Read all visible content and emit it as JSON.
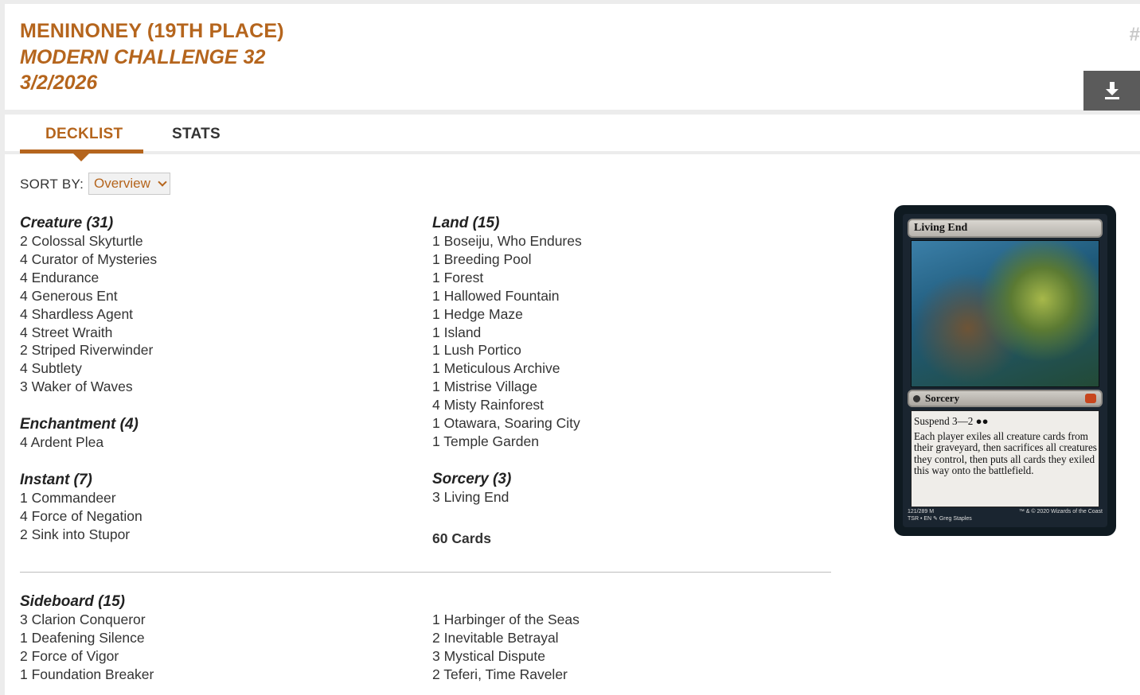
{
  "header": {
    "player": "MENINONEY (19TH PLACE)",
    "event": "MODERN CHALLENGE 32",
    "date": "3/2/2026",
    "hash_mark": "#"
  },
  "tabs": [
    {
      "label": "DECKLIST",
      "active": true
    },
    {
      "label": "STATS",
      "active": false
    }
  ],
  "sort": {
    "label": "SORT BY:",
    "selected": "Overview"
  },
  "maindeck": {
    "left_column": [
      {
        "title": "Creature (31)",
        "cards": [
          "2 Colossal Skyturtle",
          "4 Curator of Mysteries",
          "4 Endurance",
          "4 Generous Ent",
          "4 Shardless Agent",
          "4 Street Wraith",
          "2 Striped Riverwinder",
          "4 Subtlety",
          "3 Waker of Waves"
        ]
      },
      {
        "title": "Enchantment (4)",
        "cards": [
          "4 Ardent Plea"
        ]
      },
      {
        "title": "Instant (7)",
        "cards": [
          "1 Commandeer",
          "4 Force of Negation",
          "2 Sink into Stupor"
        ]
      }
    ],
    "right_column": [
      {
        "title": "Land (15)",
        "cards": [
          "1 Boseiju, Who Endures",
          "1 Breeding Pool",
          "1 Forest",
          "1 Hallowed Fountain",
          "1 Hedge Maze",
          "1 Island",
          "1 Lush Portico",
          "1 Meticulous Archive",
          "1 Mistrise Village",
          "4 Misty Rainforest",
          "1 Otawara, Soaring City",
          "1 Temple Garden"
        ]
      },
      {
        "title": "Sorcery (3)",
        "cards": [
          "3 Living End"
        ]
      }
    ],
    "total": "60 Cards"
  },
  "sideboard": {
    "title": "Sideboard (15)",
    "left": [
      "3 Clarion Conqueror",
      "1 Deafening Silence",
      "2 Force of Vigor",
      "1 Foundation Breaker"
    ],
    "right": [
      "1 Harbinger of the Seas",
      "2 Inevitable Betrayal",
      "3 Mystical Dispute",
      "2 Teferi, Time Raveler"
    ]
  },
  "card_preview": {
    "name": "Living End",
    "type": "Sorcery",
    "suspend": "Suspend 3—2",
    "rules_text": "Each player exiles all creature cards from their graveyard, then sacrifices all creatures they control, then puts all cards they exiled this way onto the battlefield.",
    "collector": "121/289 M",
    "set_line": "TSR • EN",
    "artist": "Greg Staples",
    "copyright": "™ & © 2020 Wizards of the Coast",
    "colors": {
      "frame": "#0f1a21",
      "accent": "#b5651d"
    }
  },
  "icons": {
    "download": "download-icon",
    "sort_chevron": "chevron-down-icon"
  }
}
